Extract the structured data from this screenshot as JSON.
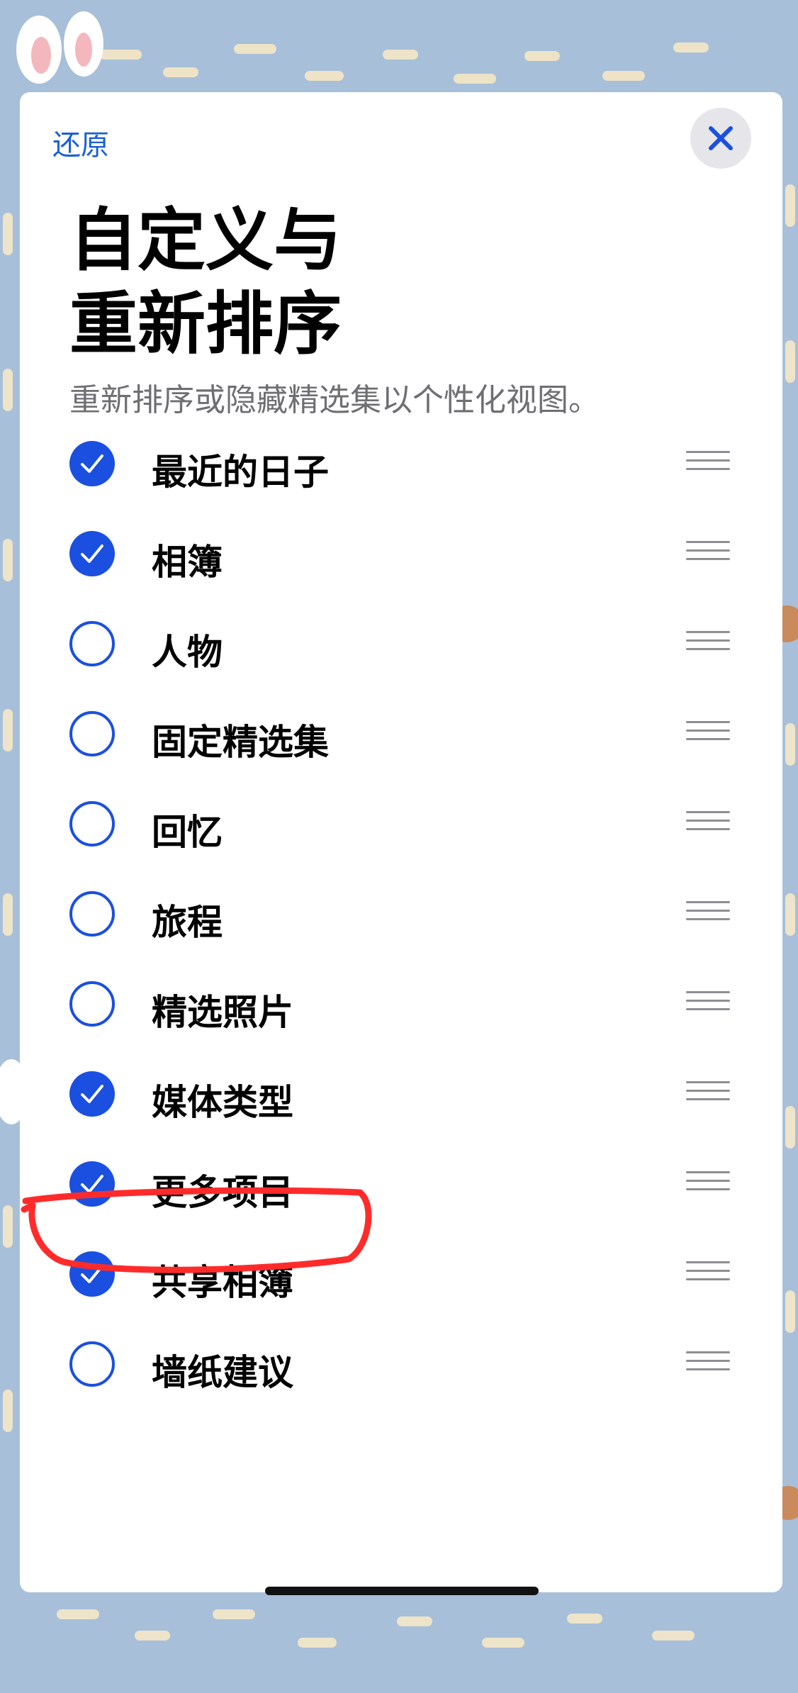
{
  "header": {
    "restore_label": "还原",
    "close_icon": "close-icon",
    "title_line1": "自定义与",
    "title_line2": "重新排序",
    "subtitle": "重新排序或隐藏精选集以个性化视图。"
  },
  "colors": {
    "accent": "#1a4fe0",
    "link": "#1a5fd6",
    "annotation": "#ff2b2b",
    "background": "#a7bfd9"
  },
  "items": [
    {
      "label": "最近的日子",
      "checked": true
    },
    {
      "label": "相簿",
      "checked": true
    },
    {
      "label": "人物",
      "checked": false
    },
    {
      "label": "固定精选集",
      "checked": false
    },
    {
      "label": "回忆",
      "checked": false
    },
    {
      "label": "旅程",
      "checked": false
    },
    {
      "label": "精选照片",
      "checked": false
    },
    {
      "label": "媒体类型",
      "checked": true
    },
    {
      "label": "更多项目",
      "checked": true
    },
    {
      "label": "共享相簿",
      "checked": true
    },
    {
      "label": "墙纸建议",
      "checked": false
    }
  ]
}
